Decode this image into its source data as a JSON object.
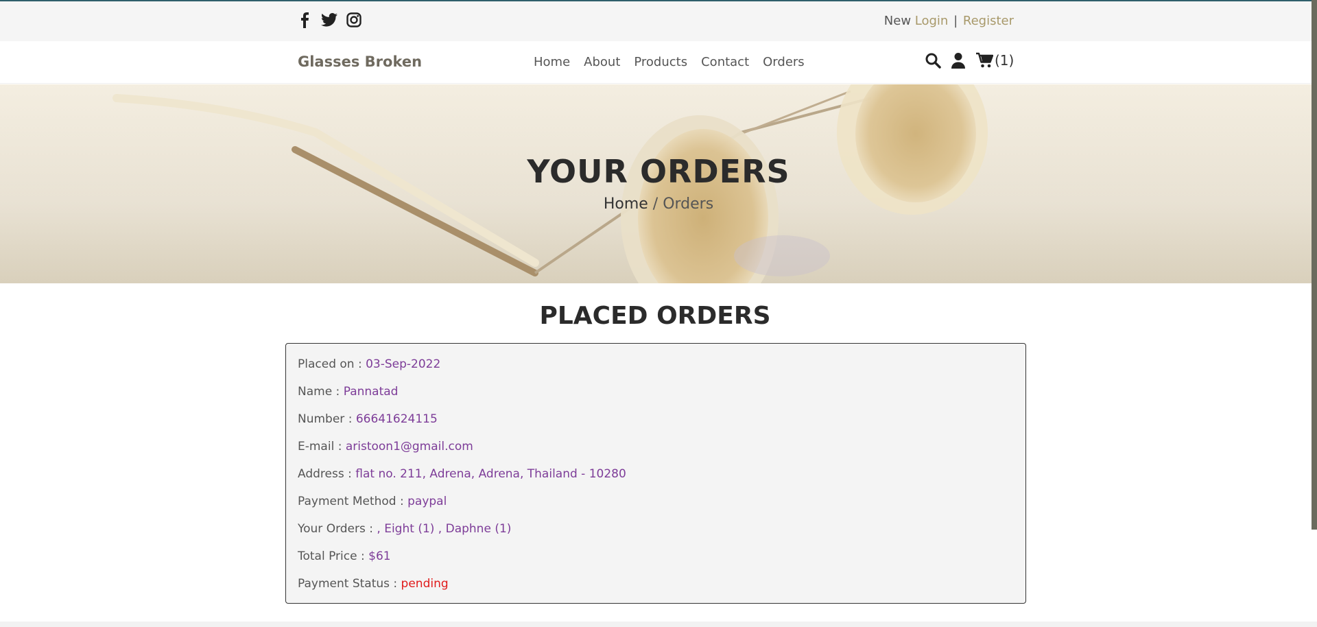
{
  "topbar": {
    "social_icons": [
      "facebook-icon",
      "twitter-icon",
      "instagram-icon"
    ],
    "new_label": "New",
    "login_label": "Login",
    "separator": "|",
    "register_label": "Register"
  },
  "navbar": {
    "brand": "Glasses Broken",
    "menu": [
      "Home",
      "About",
      "Products",
      "Contact",
      "Orders"
    ],
    "icons": [
      "search-icon",
      "user-icon",
      "cart-icon"
    ],
    "cart_count": "(1)"
  },
  "hero": {
    "title": "YOUR ORDERS",
    "breadcrumb_home": "Home",
    "breadcrumb_sep": " / ",
    "breadcrumb_current": "Orders"
  },
  "section": {
    "title": "PLACED ORDERS"
  },
  "order": {
    "rows": [
      {
        "label": "Placed on : ",
        "value": "03-Sep-2022"
      },
      {
        "label": "Name : ",
        "value": "Pannatad"
      },
      {
        "label": "Number : ",
        "value": "66641624115"
      },
      {
        "label": "E-mail : ",
        "value": "aristoon1@gmail.com"
      },
      {
        "label": "Address : ",
        "value": "flat no. 211, Adrena, Adrena, Thailand - 10280"
      },
      {
        "label": "Payment Method : ",
        "value": "paypal"
      },
      {
        "label": "Your Orders : ",
        "value": ", Eight (1) , Daphne (1)"
      },
      {
        "label": "Total Price : ",
        "value": "$61"
      },
      {
        "label": "Payment Status : ",
        "value": "pending"
      }
    ]
  },
  "colors": {
    "accent_link": "#a8996a",
    "value_purple": "#7d3c98",
    "status_pending": "#e01b1b"
  }
}
